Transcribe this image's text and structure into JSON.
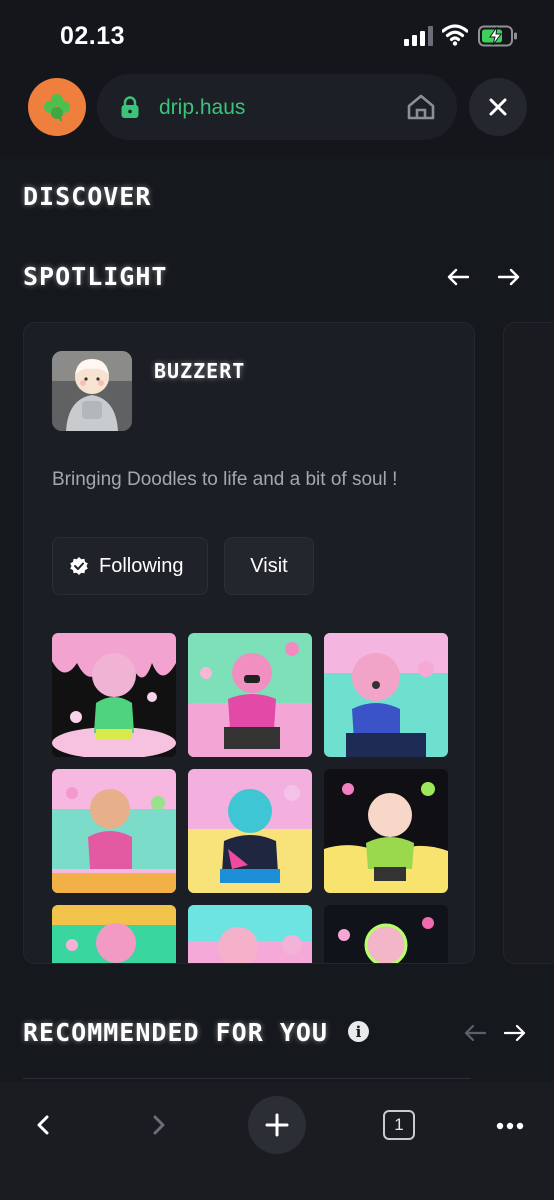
{
  "status": {
    "time": "02.13"
  },
  "browser": {
    "url": "drip.haus"
  },
  "headings": {
    "discover": "DISCOVER",
    "spotlight": "SPOTLIGHT",
    "recommended": "RECOMMENDED FOR YOU"
  },
  "creator": {
    "name": "BUZZERT",
    "bio": "Bringing Doodles to life and a bit of soul !",
    "following_label": "Following",
    "visit_label": "Visit"
  },
  "bottom": {
    "tab_count": "1"
  },
  "colors": {
    "accent_green": "#3cc37a",
    "avatar_orange": "#ef7f3c"
  },
  "icons": [
    "signal-icon",
    "wifi-icon",
    "battery-charging-icon",
    "clover-icon",
    "lock-icon",
    "home-icon",
    "close-icon",
    "arrow-left-icon",
    "arrow-right-icon",
    "verified-icon",
    "info-icon",
    "back-icon",
    "forward-icon",
    "plus-icon",
    "tabs-icon",
    "more-icon"
  ]
}
